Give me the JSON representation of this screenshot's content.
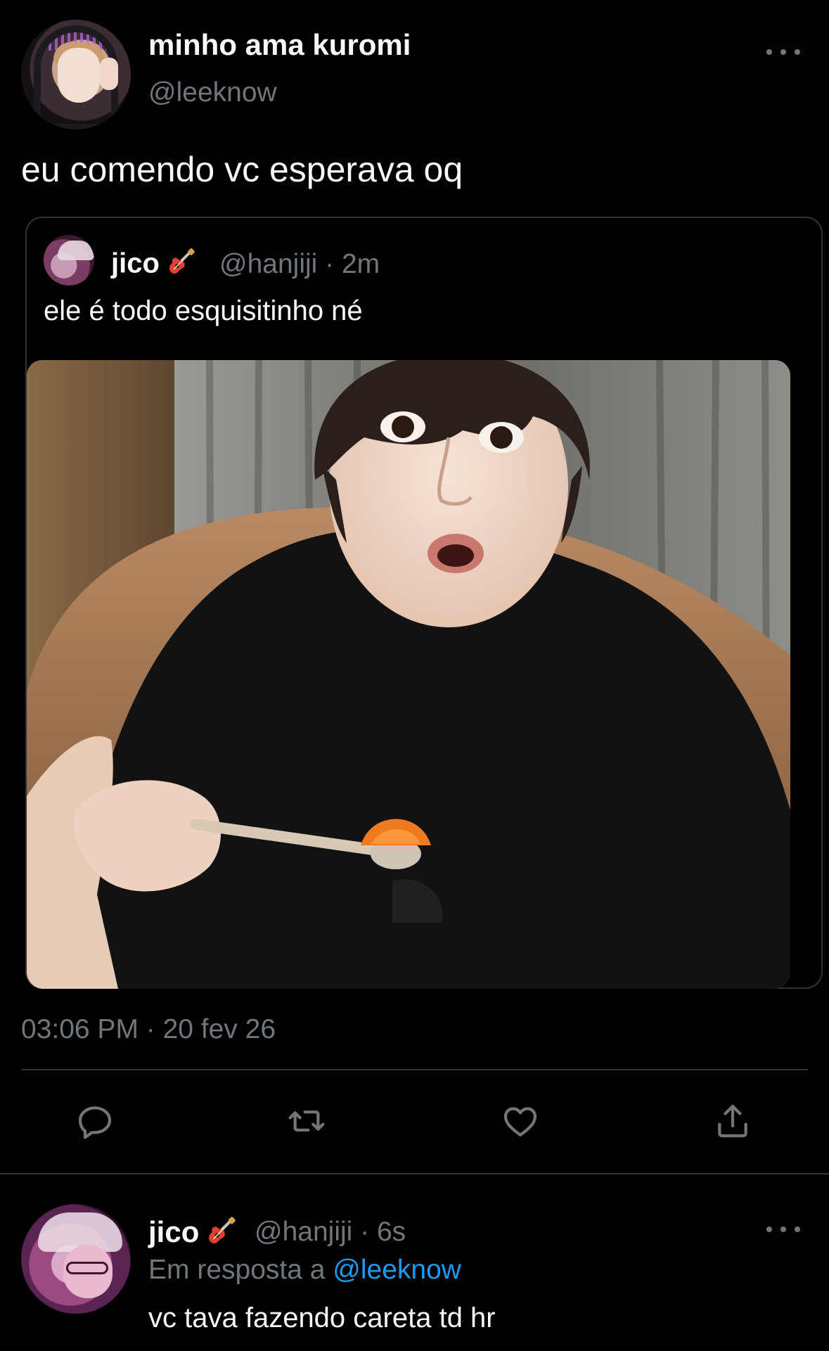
{
  "main_tweet": {
    "display_name": "minho ama kuromi",
    "handle": "@leeknow",
    "text": "eu comendo vc esperava oq",
    "more_icon": "more-horizontal-icon",
    "timestamp": "03:06 PM · 20 fev 26"
  },
  "quoted_tweet": {
    "display_name": "jico",
    "name_emoji": "guitar-icon",
    "handle_time": "@hanjiji · 2m",
    "text": "ele é todo esquisitinho né",
    "media": "photo of a man in a black t-shirt holding a spoon with an orange slice, surprised expression"
  },
  "actions": [
    {
      "name": "reply",
      "icon": "reply-icon"
    },
    {
      "name": "retweet",
      "icon": "retweet-icon"
    },
    {
      "name": "like",
      "icon": "heart-icon"
    },
    {
      "name": "share",
      "icon": "share-icon"
    }
  ],
  "reply": {
    "display_name": "jico",
    "name_emoji": "guitar-icon",
    "handle_time": "@hanjiji · 6s",
    "reply_prefix": "Em resposta a",
    "reply_mention": "@leeknow",
    "text": "vc tava fazendo careta td hr",
    "more_icon": "more-horizontal-icon"
  },
  "colors": {
    "background": "#000000",
    "primary_text": "#f7f9f9",
    "secondary_text": "#71767b",
    "link": "#1d9bf0",
    "border": "#2f3336"
  }
}
